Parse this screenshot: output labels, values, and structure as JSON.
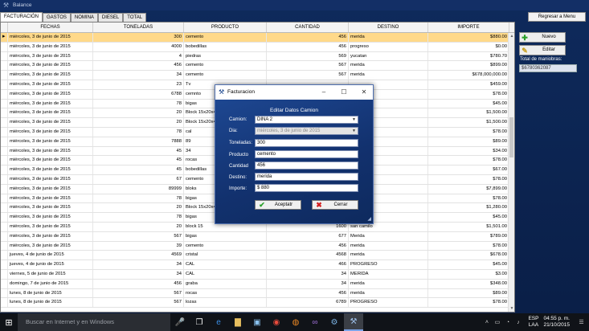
{
  "window": {
    "title": "Balance"
  },
  "tabs": [
    "FACTURACIÓN",
    "GASTOS",
    "NOMINA",
    "DIESEL",
    "TOTAL"
  ],
  "right": {
    "regresar": "Regresar a Menu",
    "nuevo": "Nuevo",
    "editar": "Editar",
    "total_label": "Total de maniobras:",
    "total_value": "$6780362087"
  },
  "table": {
    "headers": [
      "FECHAS",
      "TONELADAS",
      "PRODUCTO",
      "CANTIDAD",
      "DESTINO",
      "IMPORTE"
    ],
    "rows": [
      [
        "miércoles, 3 de junio de 2015",
        "300",
        "cemento",
        "456",
        "merida",
        "$880.00"
      ],
      [
        "miércoles, 3 de junio de 2015",
        "4000",
        "bobedillas",
        "456",
        "progreso",
        "$0.00"
      ],
      [
        "miércoles, 3 de junio de 2015",
        "4",
        "piedras",
        "569",
        "yucatan",
        "$780.70"
      ],
      [
        "miércoles, 3 de junio de 2015",
        "456",
        "cemento",
        "567",
        "merida",
        "$899.00"
      ],
      [
        "miércoles, 3 de junio de 2015",
        "34",
        "cemento",
        "567",
        "merida",
        "$678,000,000.00"
      ],
      [
        "miércoles, 3 de junio de 2015",
        "23",
        "Tv",
        "",
        "",
        "$459.00"
      ],
      [
        "miércoles, 3 de junio de 2015",
        "6788",
        "cemnto",
        "",
        "",
        "$78.00"
      ],
      [
        "miércoles, 3 de junio de 2015",
        "78",
        "bigas",
        "",
        "",
        "$45.00"
      ],
      [
        "miércoles, 3 de junio de 2015",
        "20",
        "Block 15x20x40",
        "",
        "",
        "$1,500.00"
      ],
      [
        "miércoles, 3 de junio de 2015",
        "20",
        "Block 15x20x40",
        "",
        "",
        "$1,500.00"
      ],
      [
        "miércoles, 3 de junio de 2015",
        "78",
        "cal",
        "",
        "",
        "$78.00"
      ],
      [
        "miércoles, 3 de junio de 2015",
        "7888",
        "89",
        "",
        "",
        "$89.00"
      ],
      [
        "miércoles, 3 de junio de 2015",
        "45",
        "34",
        "",
        "",
        "$34.00"
      ],
      [
        "miércoles, 3 de junio de 2015",
        "45",
        "rocas",
        "",
        "",
        "$78.00"
      ],
      [
        "miércoles, 3 de junio de 2015",
        "45",
        "bobedillas",
        "",
        "",
        "$67.00"
      ],
      [
        "miércoles, 3 de junio de 2015",
        "67",
        "cemento",
        "",
        "",
        "$78.00"
      ],
      [
        "miércoles, 3 de junio de 2015",
        "89999",
        "bloks",
        "",
        "",
        "$7,899.00"
      ],
      [
        "miércoles, 3 de junio de 2015",
        "78",
        "bigas",
        "",
        "",
        "$78.00"
      ],
      [
        "miércoles, 3 de junio de 2015",
        "20",
        "Block 15x20x40",
        "",
        "",
        "$1,280.00"
      ],
      [
        "miércoles, 3 de junio de 2015",
        "78",
        "bigas",
        "",
        "",
        "$45.00"
      ],
      [
        "miércoles, 3 de junio de 2015",
        "20",
        "block 15",
        "1600",
        "san camilo",
        "$1,501.00"
      ],
      [
        "miércoles, 3 de junio de 2015",
        "567",
        "bigas",
        "677",
        "Merida",
        "$789.00"
      ],
      [
        "miércoles, 3 de junio de 2015",
        "39",
        "cemento",
        "456",
        "merida",
        "$78.00"
      ],
      [
        "jueves, 4 de junio de 2015",
        "4569",
        "cristal",
        "4568",
        "merida",
        "$678.00"
      ],
      [
        "jueves, 4 de junio de 2015",
        "34",
        "CAL",
        "466",
        "PROGRESO",
        "$45.00"
      ],
      [
        "viernes, 5 de junio de 2015",
        "34",
        "CAL",
        "34",
        "MERIDA",
        "$3.00"
      ],
      [
        "domingo, 7 de junio de 2015",
        "456",
        "graba",
        "34",
        "merida",
        "$348.00"
      ],
      [
        "lunes, 8 de junio de 2015",
        "567",
        "rocas",
        "456",
        "merida",
        "$89.00"
      ],
      [
        "lunes, 8 de junio de 2015",
        "567",
        "lozas",
        "6789",
        "PROGRESO",
        "$78.00"
      ]
    ]
  },
  "dialog": {
    "title": "Facturacion",
    "heading": "Editar Datos Camion",
    "labels": {
      "camion": "Camion:",
      "dia": "Dia:",
      "toneladas": "Toneladas:",
      "producto": "Producto",
      "cantidad": "Cantidad",
      "destino": "Destino:",
      "importe": "Importe:"
    },
    "values": {
      "camion": "DINA 2",
      "dia": "miércoles, 3 de junio de 2015",
      "toneladas": "300",
      "producto": "cemento",
      "cantidad": "456",
      "destino": "merida",
      "importe": "$ 880"
    },
    "aceptar": "Aceptatr",
    "cerrar": "Cerrar"
  },
  "taskbar": {
    "search": "Buscar en Internet y en Windows",
    "lang1": "ESP",
    "lang2": "LAA",
    "time": "04:55 p. m.",
    "date": "21/10/2015"
  }
}
